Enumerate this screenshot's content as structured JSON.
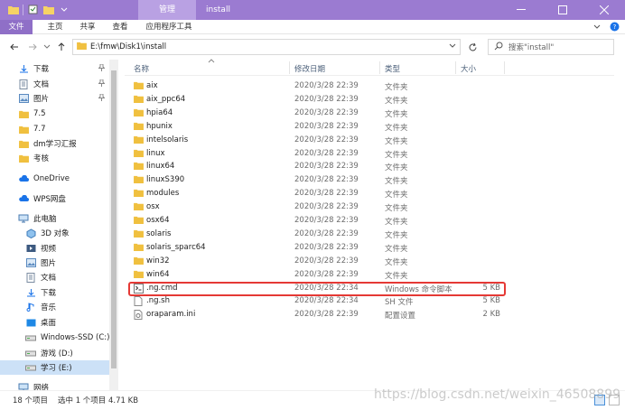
{
  "window": {
    "manage_tab": "管理",
    "title": "install"
  },
  "ribbon": {
    "tabs": [
      "文件",
      "主页",
      "共享",
      "查看",
      "应用程序工具"
    ]
  },
  "address": {
    "path": "E:\\fmw\\Disk1\\install",
    "search_placeholder": "搜索\"install\""
  },
  "sidebar": {
    "items": [
      {
        "label": "下载",
        "icon": "download-icon",
        "pinned": true
      },
      {
        "label": "文档",
        "icon": "document-icon",
        "pinned": true
      },
      {
        "label": "图片",
        "icon": "picture-icon",
        "pinned": true
      },
      {
        "label": "7.5",
        "icon": "folder-icon",
        "pinned": false
      },
      {
        "label": "7.7",
        "icon": "folder-icon",
        "pinned": false
      },
      {
        "label": "dm学习汇报",
        "icon": "folder-icon",
        "pinned": false
      },
      {
        "label": "考核",
        "icon": "folder-icon",
        "pinned": false
      },
      {
        "label": "OneDrive",
        "icon": "cloud-icon",
        "pinned": false
      },
      {
        "label": "WPS网盘",
        "icon": "cloud-icon",
        "pinned": false
      },
      {
        "label": "此电脑",
        "icon": "computer-icon",
        "pinned": false
      },
      {
        "label": "3D 对象",
        "icon": "cube-icon",
        "pinned": false
      },
      {
        "label": "视频",
        "icon": "video-icon",
        "pinned": false
      },
      {
        "label": "图片",
        "icon": "picture-icon",
        "pinned": false
      },
      {
        "label": "文档",
        "icon": "document-icon",
        "pinned": false
      },
      {
        "label": "下载",
        "icon": "download-icon",
        "pinned": false
      },
      {
        "label": "音乐",
        "icon": "music-icon",
        "pinned": false
      },
      {
        "label": "桌面",
        "icon": "desktop-icon",
        "pinned": false
      },
      {
        "label": "Windows-SSD (C:)",
        "icon": "drive-icon",
        "pinned": false
      },
      {
        "label": "游戏 (D:)",
        "icon": "drive-icon",
        "pinned": false
      },
      {
        "label": "学习 (E:)",
        "icon": "drive-icon",
        "pinned": false,
        "selected": true
      },
      {
        "label": "网络",
        "icon": "network-icon",
        "pinned": false
      }
    ]
  },
  "columns": {
    "name": "名称",
    "modified": "修改日期",
    "type": "类型",
    "size": "大小"
  },
  "files": [
    {
      "name": "aix",
      "modified": "2020/3/28 22:39",
      "type": "文件夹",
      "size": "",
      "kind": "folder"
    },
    {
      "name": "aix_ppc64",
      "modified": "2020/3/28 22:39",
      "type": "文件夹",
      "size": "",
      "kind": "folder"
    },
    {
      "name": "hpia64",
      "modified": "2020/3/28 22:39",
      "type": "文件夹",
      "size": "",
      "kind": "folder"
    },
    {
      "name": "hpunix",
      "modified": "2020/3/28 22:39",
      "type": "文件夹",
      "size": "",
      "kind": "folder"
    },
    {
      "name": "intelsolaris",
      "modified": "2020/3/28 22:39",
      "type": "文件夹",
      "size": "",
      "kind": "folder"
    },
    {
      "name": "linux",
      "modified": "2020/3/28 22:39",
      "type": "文件夹",
      "size": "",
      "kind": "folder"
    },
    {
      "name": "linux64",
      "modified": "2020/3/28 22:39",
      "type": "文件夹",
      "size": "",
      "kind": "folder"
    },
    {
      "name": "linuxS390",
      "modified": "2020/3/28 22:39",
      "type": "文件夹",
      "size": "",
      "kind": "folder"
    },
    {
      "name": "modules",
      "modified": "2020/3/28 22:39",
      "type": "文件夹",
      "size": "",
      "kind": "folder"
    },
    {
      "name": "osx",
      "modified": "2020/3/28 22:39",
      "type": "文件夹",
      "size": "",
      "kind": "folder"
    },
    {
      "name": "osx64",
      "modified": "2020/3/28 22:39",
      "type": "文件夹",
      "size": "",
      "kind": "folder"
    },
    {
      "name": "solaris",
      "modified": "2020/3/28 22:39",
      "type": "文件夹",
      "size": "",
      "kind": "folder"
    },
    {
      "name": "solaris_sparc64",
      "modified": "2020/3/28 22:39",
      "type": "文件夹",
      "size": "",
      "kind": "folder"
    },
    {
      "name": "win32",
      "modified": "2020/3/28 22:39",
      "type": "文件夹",
      "size": "",
      "kind": "folder"
    },
    {
      "name": "win64",
      "modified": "2020/3/28 22:39",
      "type": "文件夹",
      "size": "",
      "kind": "folder"
    },
    {
      "name": ".ng.cmd",
      "modified": "2020/3/28 22:34",
      "type": "Windows 命令脚本",
      "size": "5 KB",
      "kind": "script",
      "highlighted": true
    },
    {
      "name": ".ng.sh",
      "modified": "2020/3/28 22:34",
      "type": "SH 文件",
      "size": "5 KB",
      "kind": "file"
    },
    {
      "name": "oraparam.ini",
      "modified": "2020/3/28 22:39",
      "type": "配置设置",
      "size": "2 KB",
      "kind": "ini"
    }
  ],
  "status": {
    "count": "18 个项目",
    "selection": "选中 1 个项目  4.71 KB"
  },
  "watermark": "https://blog.csdn.net/weixin_46508899",
  "colors": {
    "titlebar": "#9b7bd1",
    "accent": "#8f6fc7",
    "selection": "#cce1f7",
    "highlight": "#e53935",
    "folder": "#f0c040"
  }
}
